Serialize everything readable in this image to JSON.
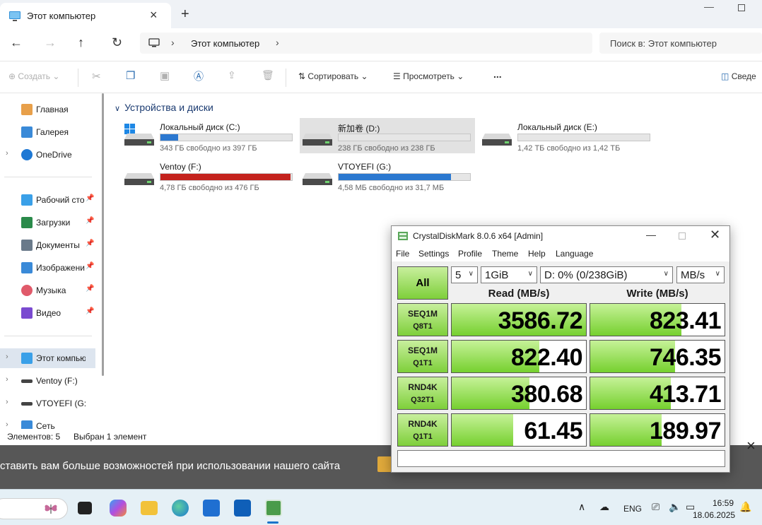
{
  "explorer": {
    "tab_title": "Этот компьютер",
    "address": {
      "crumb": "Этот компьютер",
      "separator": "›"
    },
    "search_placeholder": "Поиск в: Этот компьютер",
    "toolbar": {
      "create_label": "Создать",
      "sort_label": "Сортировать",
      "view_label": "Просмотреть",
      "more_label": "...",
      "details_label": "Сведе"
    },
    "sidebar": {
      "items": [
        {
          "label": "Главная",
          "icon": "home-icon"
        },
        {
          "label": "Галерея",
          "icon": "gallery-icon"
        },
        {
          "label": "OneDrive",
          "icon": "onedrive-icon"
        },
        {
          "label": "Рабочий сто",
          "icon": "desktop-icon"
        },
        {
          "label": "Загрузки",
          "icon": "download-icon"
        },
        {
          "label": "Документы",
          "icon": "documents-icon"
        },
        {
          "label": "Изображени",
          "icon": "pictures-icon"
        },
        {
          "label": "Музыка",
          "icon": "music-icon"
        },
        {
          "label": "Видео",
          "icon": "video-icon"
        },
        {
          "label": "Этот компьюте",
          "icon": "computer-icon"
        },
        {
          "label": "Ventoy (F:)",
          "icon": "drive-icon"
        },
        {
          "label": "VTOYEFI (G:)",
          "icon": "drive-icon"
        },
        {
          "label": "Сеть",
          "icon": "network-icon"
        }
      ]
    },
    "group_title": "Устройства и диски",
    "drives": [
      {
        "name": "Локальный диск (C:)",
        "free": "343 ГБ свободно из 397 ГБ",
        "used_fraction": 0.136,
        "color": "#2b78d0"
      },
      {
        "name": "新加卷 (D:)",
        "free": "238 ГБ свободно из 238 ГБ",
        "used_fraction": 0.0,
        "color": "#2b78d0"
      },
      {
        "name": "Локальный диск (E:)",
        "free": "1,42 ТБ свободно из 1,42 ТБ",
        "used_fraction": 0.0,
        "color": "#2b78d0"
      },
      {
        "name": "Ventoy (F:)",
        "free": "4,78 ГБ свободно из 476 ГБ",
        "used_fraction": 0.99,
        "color": "#c4221d"
      },
      {
        "name": "VTOYEFI (G:)",
        "free": "4,58 МБ свободно из 31,7 МБ",
        "used_fraction": 0.856,
        "color": "#2b78d0"
      }
    ],
    "status": {
      "items_count": "Элементов: 5",
      "selected": "Выбран 1 элемент"
    }
  },
  "banner": {
    "text": "ставить вам больше возможностей при использовании нашего сайта"
  },
  "taskbar": {
    "lang": "ENG",
    "time": "16:59",
    "date": "18.06.2025"
  },
  "cdm": {
    "title": "CrystalDiskMark 8.0.6 x64 [Admin]",
    "menu": [
      "File",
      "Settings",
      "Profile",
      "Theme",
      "Help",
      "Language"
    ],
    "all_label": "All",
    "count": "5",
    "size": "1GiB",
    "drive": "D: 0% (0/238GiB)",
    "unit": "MB/s",
    "read_head": "Read (MB/s)",
    "write_head": "Write (MB/s)",
    "rows": [
      {
        "l1": "SEQ1M",
        "l2": "Q8T1",
        "read": "3586.72",
        "write": "823.41",
        "read_fill": 1.0,
        "write_fill": 0.68
      },
      {
        "l1": "SEQ1M",
        "l2": "Q1T1",
        "read": "822.40",
        "write": "746.35",
        "read_fill": 0.65,
        "write_fill": 0.63
      },
      {
        "l1": "RND4K",
        "l2": "Q32T1",
        "read": "380.68",
        "write": "413.71",
        "read_fill": 0.58,
        "write_fill": 0.6
      },
      {
        "l1": "RND4K",
        "l2": "Q1T1",
        "read": "61.45",
        "write": "189.97",
        "read_fill": 0.46,
        "write_fill": 0.53
      }
    ]
  }
}
